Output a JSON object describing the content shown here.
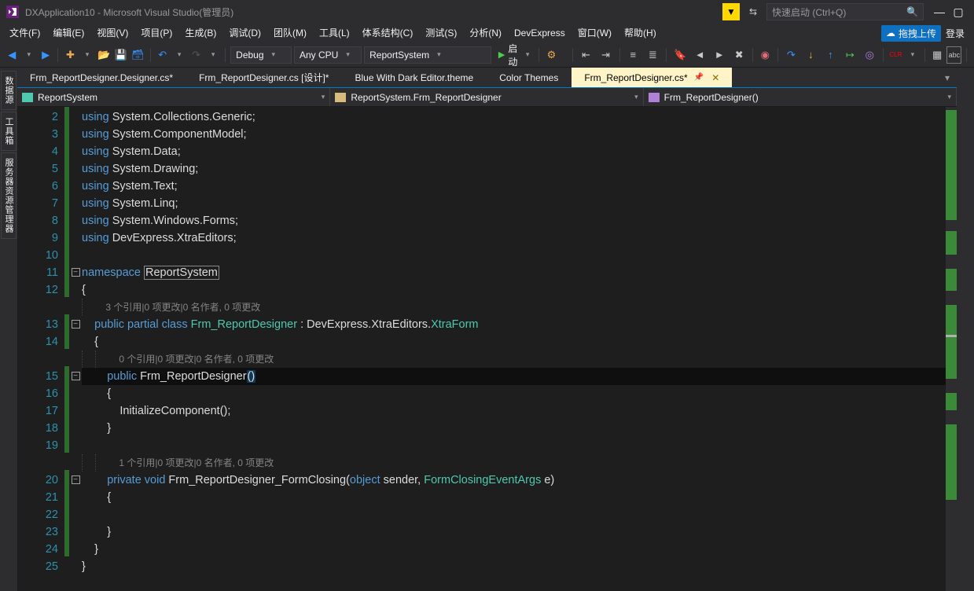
{
  "title": "DXApplication10 - Microsoft Visual Studio(管理员)",
  "search_placeholder": "快速启动 (Ctrl+Q)",
  "cloud_label": "拖拽上传",
  "login_label": "登录",
  "menu": {
    "file": "文件(F)",
    "edit": "编辑(E)",
    "view": "视图(V)",
    "project": "项目(P)",
    "build": "生成(B)",
    "debug": "调试(D)",
    "team": "团队(M)",
    "tools": "工具(L)",
    "arch": "体系结构(C)",
    "test": "测试(S)",
    "analyze": "分析(N)",
    "devexpress": "DevExpress",
    "window": "窗口(W)",
    "help": "帮助(H)"
  },
  "toolbar": {
    "config": "Debug",
    "platform": "Any CPU",
    "startup": "ReportSystem",
    "start_label": "启动"
  },
  "tabs": [
    {
      "label": "Frm_ReportDesigner.Designer.cs*",
      "active": false
    },
    {
      "label": "Frm_ReportDesigner.cs [设计]*",
      "active": false
    },
    {
      "label": "Blue With Dark Editor.theme",
      "active": false
    },
    {
      "label": "Color Themes",
      "active": false
    },
    {
      "label": "Frm_ReportDesigner.cs*",
      "active": true
    }
  ],
  "nav": {
    "project": "ReportSystem",
    "class": "ReportSystem.Frm_ReportDesigner",
    "member": "Frm_ReportDesigner()"
  },
  "left_tabs": [
    "数据源",
    "工具箱",
    "服务器资源管理器"
  ],
  "editor": {
    "codelens1": "3 个引用|0 项更改|0 名作者, 0 项更改",
    "codelens2": "0 个引用|0 项更改|0 名作者, 0 项更改",
    "codelens3": "1 个引用|0 项更改|0 名作者, 0 项更改",
    "lines": [
      {
        "n": 2,
        "chg": true,
        "code": [
          [
            "kw",
            "using"
          ],
          [
            "txt",
            " System.Collections.Generic;"
          ]
        ]
      },
      {
        "n": 3,
        "chg": true,
        "code": [
          [
            "kw",
            "using"
          ],
          [
            "txt",
            " System.ComponentModel;"
          ]
        ]
      },
      {
        "n": 4,
        "chg": true,
        "code": [
          [
            "kw",
            "using"
          ],
          [
            "txt",
            " System.Data;"
          ]
        ]
      },
      {
        "n": 5,
        "chg": true,
        "code": [
          [
            "kw",
            "using"
          ],
          [
            "txt",
            " System.Drawing;"
          ]
        ]
      },
      {
        "n": 6,
        "chg": true,
        "code": [
          [
            "kw",
            "using"
          ],
          [
            "txt",
            " System.Text;"
          ]
        ]
      },
      {
        "n": 7,
        "chg": true,
        "code": [
          [
            "kw",
            "using"
          ],
          [
            "txt",
            " System.Linq;"
          ]
        ]
      },
      {
        "n": 8,
        "chg": true,
        "code": [
          [
            "kw",
            "using"
          ],
          [
            "txt",
            " System.Windows.Forms;"
          ]
        ]
      },
      {
        "n": 9,
        "chg": true,
        "code": [
          [
            "kw",
            "using"
          ],
          [
            "txt",
            " DevExpress.XtraEditors;"
          ]
        ]
      },
      {
        "n": 10,
        "chg": true,
        "code": []
      },
      {
        "n": 11,
        "chg": true,
        "fold": true,
        "code": [
          [
            "kw",
            "namespace"
          ],
          [
            "txt",
            " "
          ],
          [
            "hl",
            "ReportSystem"
          ]
        ]
      },
      {
        "n": 12,
        "chg": true,
        "indent": 0,
        "code": [
          [
            "txt",
            "{"
          ]
        ]
      },
      {
        "n": "",
        "lens": "codelens1",
        "indent": 1
      },
      {
        "n": 13,
        "chg": true,
        "fold": true,
        "indent": 1,
        "code": [
          [
            "kw",
            "public"
          ],
          [
            "txt",
            " "
          ],
          [
            "kw",
            "partial"
          ],
          [
            "txt",
            " "
          ],
          [
            "kw",
            "class"
          ],
          [
            "txt",
            " "
          ],
          [
            "cls",
            "Frm_ReportDesigner"
          ],
          [
            "txt",
            " : DevExpress.XtraEditors."
          ],
          [
            "cls",
            "XtraForm"
          ]
        ]
      },
      {
        "n": 14,
        "chg": true,
        "indent": 1,
        "code": [
          [
            "txt",
            "{"
          ]
        ]
      },
      {
        "n": "",
        "lens": "codelens2",
        "indent": 2
      },
      {
        "n": 15,
        "chg": true,
        "fold": true,
        "indent": 2,
        "current": true,
        "code": [
          [
            "kw",
            "public"
          ],
          [
            "txt",
            " Frm_ReportDesigner"
          ],
          [
            "cur",
            "()"
          ]
        ]
      },
      {
        "n": 16,
        "chg": true,
        "indent": 2,
        "code": [
          [
            "txt",
            "{"
          ]
        ]
      },
      {
        "n": 17,
        "chg": true,
        "indent": 3,
        "code": [
          [
            "txt",
            "InitializeComponent();"
          ]
        ]
      },
      {
        "n": 18,
        "chg": true,
        "indent": 2,
        "code": [
          [
            "txt",
            "}"
          ]
        ]
      },
      {
        "n": 19,
        "chg": true,
        "indent": 2,
        "code": []
      },
      {
        "n": "",
        "lens": "codelens3",
        "indent": 2
      },
      {
        "n": 20,
        "chg": true,
        "fold": true,
        "indent": 2,
        "code": [
          [
            "kw",
            "private"
          ],
          [
            "txt",
            " "
          ],
          [
            "kw",
            "void"
          ],
          [
            "txt",
            " Frm_ReportDesigner_FormClosing("
          ],
          [
            "kw",
            "object"
          ],
          [
            "txt",
            " sender, "
          ],
          [
            "cls",
            "FormClosingEventArgs"
          ],
          [
            "txt",
            " e)"
          ]
        ]
      },
      {
        "n": 21,
        "chg": true,
        "indent": 2,
        "code": [
          [
            "txt",
            "{"
          ]
        ]
      },
      {
        "n": 22,
        "chg": true,
        "indent": 3,
        "code": []
      },
      {
        "n": 23,
        "chg": true,
        "indent": 2,
        "code": [
          [
            "txt",
            "}"
          ]
        ]
      },
      {
        "n": 24,
        "chg": true,
        "indent": 1,
        "code": [
          [
            "txt",
            "}"
          ]
        ]
      },
      {
        "n": 25,
        "chg": false,
        "indent": 0,
        "code": [
          [
            "txt",
            "}"
          ]
        ]
      }
    ]
  }
}
